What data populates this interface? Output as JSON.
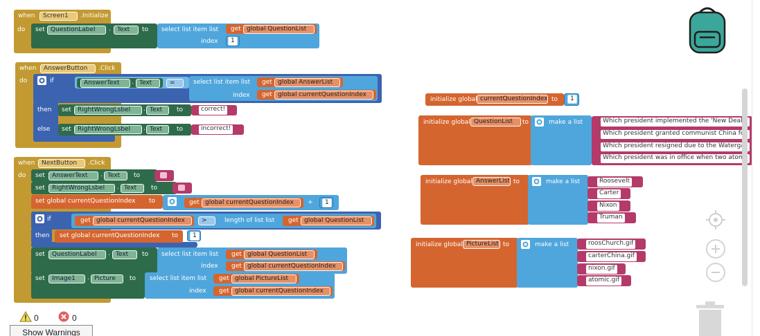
{
  "workspace": {
    "screen_init": {
      "when": "when",
      "component": "Screen1",
      "event": ".Initialize",
      "do": "do",
      "set": "set",
      "target": "QuestionLabel",
      "dot": ".",
      "prop": "Text",
      "to": "to",
      "select_label": "select list item  list",
      "index_label": "index",
      "get": "get",
      "list_var": "global QuestionList",
      "index_value": "1"
    },
    "answer_click": {
      "when": "when",
      "component": "AnswerButton",
      "event": ".Click",
      "do": "do",
      "if": "if",
      "compare_component": "AnswerText",
      "dot": ".",
      "compare_prop": "Text",
      "op": "=",
      "select_label": "select list item  list",
      "index_label": "index",
      "get": "get",
      "list_var": "global AnswerList",
      "index_var": "global currentQuestionIndex",
      "then": "then",
      "else": "else",
      "set": "set",
      "target": "RightWrongLsbel",
      "prop": "Text",
      "to": "to",
      "correct": "correct!",
      "incorrect": "incorrect!"
    },
    "next_click": {
      "when": "when",
      "component": "NextButton",
      "event": ".Click",
      "do": "do",
      "set": "set",
      "dot": ".",
      "to": "to",
      "get": "get",
      "if": "if",
      "then": "then",
      "answer_text": "AnswerText",
      "text_prop": "Text",
      "rightwrong": "RightWrongLsbel",
      "set_global": "set global currentQuestionIndex",
      "get_index": "global currentQuestionIndex",
      "plus": "+",
      "one": "1",
      "gt": ">",
      "length_label": "length of list  list",
      "question_list": "global QuestionList",
      "question_label": "QuestionLabel",
      "select_label": "select list item  list",
      "index_label": "index",
      "image": "Image1",
      "picture_prop": "Picture",
      "picture_list": "global PictureList"
    },
    "globals": {
      "init_label": "initialize global",
      "to": "to",
      "make_list": "make a list",
      "current_index": {
        "name": "currentQuestionIndex",
        "value": "1"
      },
      "question_list": {
        "name": "QuestionList",
        "items": [
          "Which president implemented the 'New Deal'",
          "Which president granted communist China for",
          "Which president resigned due to the Waterga",
          "Which president was in office when two atom"
        ]
      },
      "answer_list": {
        "name": "AnswerList",
        "items": [
          "Roosevelt",
          "Carter",
          "Nixon",
          "Truman"
        ]
      },
      "picture_list": {
        "name": "PictureList",
        "items": [
          "roosChurch.gif",
          "carterChina.gif",
          "nixon.gif",
          "atomic.gif"
        ]
      }
    }
  },
  "warnings": {
    "warning_count": "0",
    "error_count": "0",
    "button_label": "Show Warnings"
  },
  "colors": {
    "event": "#c39a32",
    "component": "#2e6b4a",
    "list": "#4fa6dc",
    "variable": "#d5652f",
    "text": "#b43a6a",
    "control": "#3c63b0"
  },
  "icons": [
    "backpack-icon",
    "target-icon",
    "zoom-in-icon",
    "zoom-out-icon",
    "trash-icon",
    "warning-icon",
    "error-icon",
    "gear-icon"
  ]
}
